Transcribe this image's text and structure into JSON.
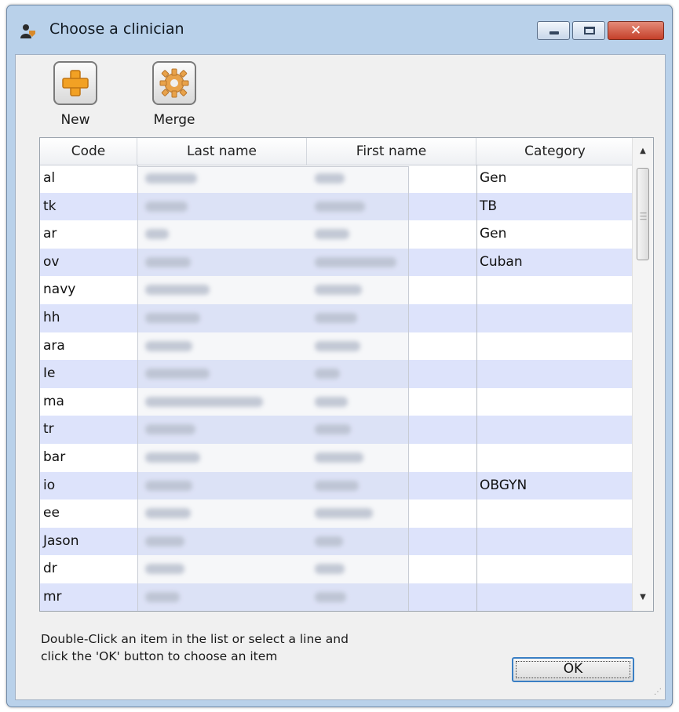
{
  "window": {
    "title": "Choose a clinician",
    "close_label": "✕"
  },
  "toolbar": {
    "new_label": "New",
    "merge_label": "Merge"
  },
  "table": {
    "columns": [
      "Code",
      "Last name",
      "First name",
      "Category"
    ],
    "rows": [
      {
        "code": "al",
        "category": "Gen"
      },
      {
        "code": "tk",
        "category": "TB"
      },
      {
        "code": "ar",
        "category": "Gen"
      },
      {
        "code": "ov",
        "category": "Cuban"
      },
      {
        "code": "navy",
        "category": ""
      },
      {
        "code": "hh",
        "category": ""
      },
      {
        "code": "ara",
        "category": ""
      },
      {
        "code": "Ie",
        "category": ""
      },
      {
        "code": "ma",
        "category": ""
      },
      {
        "code": "tr",
        "category": ""
      },
      {
        "code": "bar",
        "category": ""
      },
      {
        "code": "io",
        "category": "OBGYN"
      },
      {
        "code": "ee",
        "category": ""
      },
      {
        "code": "Jason",
        "category": ""
      },
      {
        "code": "dr",
        "category": ""
      },
      {
        "code": "mr",
        "category": ""
      }
    ]
  },
  "footer": {
    "hint_line1": "Double-Click an item in the list or select a line and",
    "hint_line2": "click the 'OK' button to choose an item",
    "ok_label": "OK"
  },
  "colors": {
    "row_alt": "#dde3fb",
    "titlebar": "#b9d1ea",
    "close_button": "#c5402a"
  }
}
